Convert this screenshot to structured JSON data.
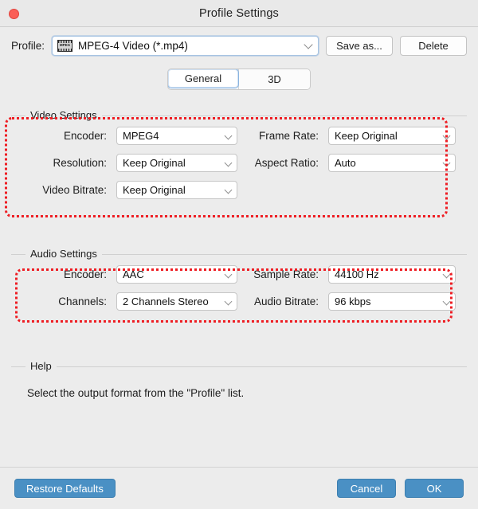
{
  "window": {
    "title": "Profile Settings",
    "close_icon": "close-dot-icon"
  },
  "profile_bar": {
    "label": "Profile:",
    "icon": "mpeg-film-icon",
    "icon_text": "MPEG",
    "value": "MPEG-4 Video (*.mp4)",
    "save_as_label": "Save as...",
    "delete_label": "Delete"
  },
  "tabs": [
    {
      "label": "General",
      "active": true
    },
    {
      "label": "3D",
      "active": false
    }
  ],
  "video_settings": {
    "legend": "Video Settings",
    "fields": [
      {
        "label": "Encoder:",
        "value": "MPEG4"
      },
      {
        "label": "Frame Rate:",
        "value": "Keep Original"
      },
      {
        "label": "Resolution:",
        "value": "Keep Original"
      },
      {
        "label": "Aspect Ratio:",
        "value": "Auto"
      },
      {
        "label": "Video Bitrate:",
        "value": "Keep Original"
      }
    ]
  },
  "audio_settings": {
    "legend": "Audio Settings",
    "fields": [
      {
        "label": "Encoder:",
        "value": "AAC"
      },
      {
        "label": "Sample Rate:",
        "value": "44100 Hz"
      },
      {
        "label": "Channels:",
        "value": "2 Channels Stereo"
      },
      {
        "label": "Audio Bitrate:",
        "value": "96 kbps"
      }
    ]
  },
  "help": {
    "legend": "Help",
    "text": "Select the output format from the \"Profile\" list."
  },
  "footer": {
    "restore_label": "Restore Defaults",
    "cancel_label": "Cancel",
    "ok_label": "OK"
  },
  "colors": {
    "accent_button": "#4a90c4",
    "annotation": "#ee1d23",
    "close_dot": "#fa5f57",
    "window_bg": "#ececec"
  }
}
